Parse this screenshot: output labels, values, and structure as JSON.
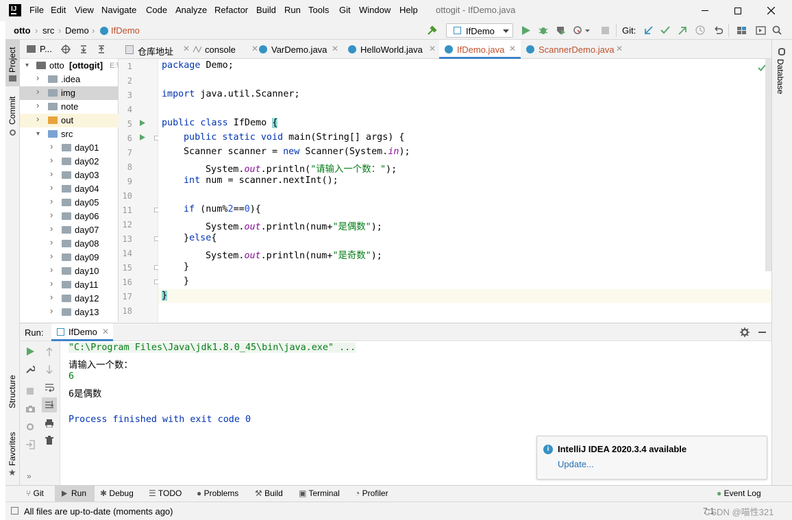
{
  "window": {
    "title": "ottogit - IfDemo.java",
    "menu": [
      "File",
      "Edit",
      "View",
      "Navigate",
      "Code",
      "Analyze",
      "Refactor",
      "Build",
      "Run",
      "Tools",
      "Git",
      "Window",
      "Help"
    ]
  },
  "navbar": {
    "breadcrumbs": [
      "otto",
      "src",
      "Demo",
      "IfDemo"
    ],
    "run_config": "IfDemo",
    "git_label": "Git:"
  },
  "left_stripe": {
    "project": "Project",
    "commit": "Commit",
    "structure": "Structure",
    "favorites": "Favorites"
  },
  "project_panel": {
    "header": "P...",
    "root": {
      "name": "otto",
      "bold_suffix": "[ottogit]",
      "path": "E:\\"
    },
    "items": [
      {
        "name": ".idea",
        "kind": "folder"
      },
      {
        "name": "img",
        "kind": "folder"
      },
      {
        "name": "note",
        "kind": "folder"
      },
      {
        "name": "out",
        "kind": "folder-orange"
      },
      {
        "name": "src",
        "kind": "folder-blue"
      },
      {
        "name": "day01",
        "kind": "package"
      },
      {
        "name": "day02",
        "kind": "package"
      },
      {
        "name": "day03",
        "kind": "package"
      },
      {
        "name": "day04",
        "kind": "package"
      },
      {
        "name": "day05",
        "kind": "package"
      },
      {
        "name": "day06",
        "kind": "package"
      },
      {
        "name": "day07",
        "kind": "package"
      },
      {
        "name": "day08",
        "kind": "package"
      },
      {
        "name": "day09",
        "kind": "package"
      },
      {
        "name": "day10",
        "kind": "package"
      },
      {
        "name": "day11",
        "kind": "package"
      },
      {
        "name": "day12",
        "kind": "package"
      },
      {
        "name": "day13",
        "kind": "package"
      }
    ]
  },
  "editor_tabs": [
    {
      "label": "仓库地址",
      "active": false
    },
    {
      "label": "console",
      "active": false
    },
    {
      "label": "VarDemo.java",
      "active": false
    },
    {
      "label": "HelloWorld.java",
      "active": false
    },
    {
      "label": "IfDemo.java",
      "active": true
    },
    {
      "label": "ScannerDemo.java",
      "active": false
    }
  ],
  "editor": {
    "line_numbers": [
      "1",
      "2",
      "3",
      "4",
      "5",
      "6",
      "7",
      "8",
      "9",
      "10",
      "11",
      "12",
      "13",
      "14",
      "15",
      "16",
      "17",
      "18"
    ],
    "code": {
      "l1_kw": "package",
      "l1_rest": " Demo;",
      "l3_kw": "import",
      "l3_rest": " java.util.Scanner;",
      "l5_kw": "public class",
      "l5_rest": " IfDemo ",
      "l5_brace": "{",
      "l6_kw": "public static void",
      "l6_rest": " main(String[] args) {",
      "l7_a": "Scanner scanner = ",
      "l7_kw": "new",
      "l7_b": " Scanner(System.",
      "l7_it": "in",
      "l7_c": ");",
      "l8_a": "System.",
      "l8_it": "out",
      "l8_b": ".println(",
      "l8_str": "\"请输入一个数：\"",
      "l8_c": ");",
      "l9_kw": "int",
      "l9_rest": " num = scanner.nextInt();",
      "l11_kw": "if",
      "l11_a": " (num%",
      "l11_n1": "2",
      "l11_b": "==",
      "l11_n2": "0",
      "l11_c": "){",
      "l12_a": "System.",
      "l12_it": "out",
      "l12_b": ".println(num+",
      "l12_str": "\"是偶数\"",
      "l12_c": ");",
      "l13_a": "}",
      "l13_kw": "else",
      "l13_b": "{",
      "l14_a": "System.",
      "l14_it": "out",
      "l14_b": ".println(num+",
      "l14_str": "\"是奇数\"",
      "l14_c": ");",
      "l15": "}",
      "l16": "}",
      "l17": "}"
    }
  },
  "right_stripe": {
    "database": "Database"
  },
  "run_panel": {
    "label": "Run:",
    "tab": "IfDemo",
    "output": [
      {
        "text": "\"C:\\Program Files\\Java\\jdk1.8.0_45\\bin\\java.exe\" ...",
        "style": "cmd"
      },
      {
        "text": "请输入一个数：",
        "style": "normal"
      },
      {
        "text": "6",
        "style": "input"
      },
      {
        "text": "6是偶数",
        "style": "normal"
      },
      {
        "text": "",
        "style": "normal"
      },
      {
        "text": "Process finished with exit code 0",
        "style": "exit"
      }
    ]
  },
  "notification": {
    "title": "IntelliJ IDEA 2020.3.4 available",
    "link": "Update..."
  },
  "bottom_tools": [
    "Git",
    "Run",
    "Debug",
    "TODO",
    "Problems",
    "Build",
    "Terminal",
    "Profiler"
  ],
  "event_log": "Event Log",
  "status": {
    "message": "All files are up-to-date (moments ago)",
    "position": "7:1",
    "watermark": "CSDN @喵性321"
  },
  "colors": {
    "accent": "#3574f0",
    "string": "#067d17",
    "keyword": "#0033b3",
    "notification_info": "#3592c4"
  }
}
